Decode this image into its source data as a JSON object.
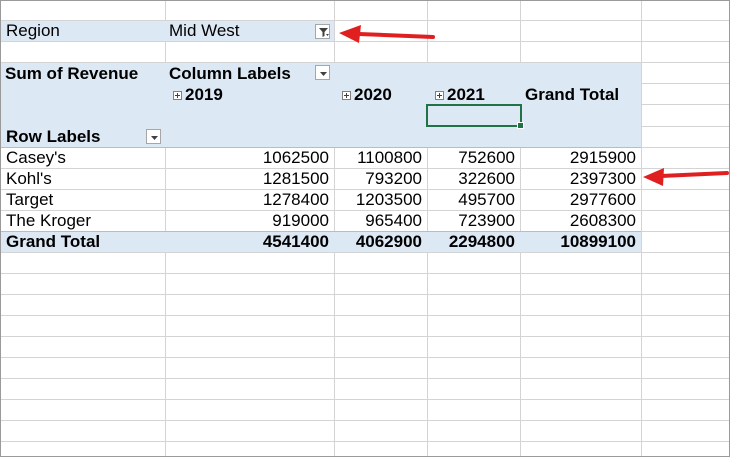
{
  "filter": {
    "label": "Region",
    "value": "Mid West"
  },
  "pivot": {
    "value_field": "Sum of Revenue",
    "column_labels": "Column Labels",
    "row_labels": "Row Labels",
    "columns": [
      "2019",
      "2020",
      "2021"
    ],
    "grand_total_label": "Grand Total",
    "rows": [
      {
        "label": "Casey's",
        "values": [
          "1062500",
          "1100800",
          "752600"
        ],
        "total": "2915900"
      },
      {
        "label": "Kohl's",
        "values": [
          "1281500",
          "793200",
          "322600"
        ],
        "total": "2397300"
      },
      {
        "label": "Target",
        "values": [
          "1278400",
          "1203500",
          "495700"
        ],
        "total": "2977600"
      },
      {
        "label": "The Kroger",
        "values": [
          "919000",
          "965400",
          "723900"
        ],
        "total": "2608300"
      }
    ],
    "grand_total_row": {
      "label": "Grand Total",
      "values": [
        "4541400",
        "4062900",
        "2294800"
      ],
      "total": "10899100"
    }
  },
  "icons": {
    "filter_button": "filter-funnel-icon",
    "dropdown": "chevron-down-icon",
    "expand": "expand-plus-icon",
    "arrow": "red-arrow-icon"
  },
  "colors": {
    "header_fill": "#dde8f5",
    "selection": "#217346",
    "arrow": "#e02020"
  }
}
